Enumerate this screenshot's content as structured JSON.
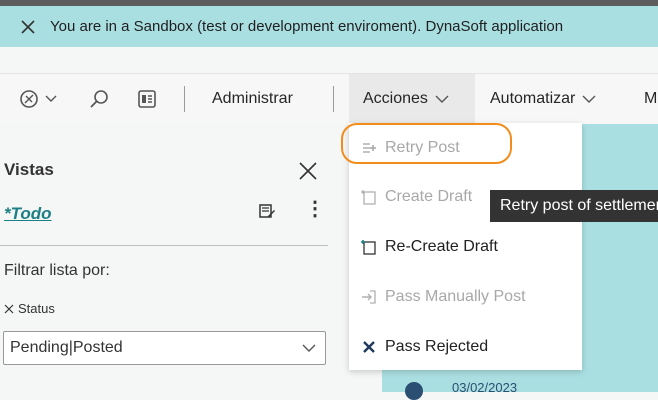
{
  "banner": {
    "text": "You are in a Sandbox (test or development enviroment). DynaSoft application"
  },
  "toolbar": {
    "administrar": "Administrar",
    "acciones": "Acciones",
    "automatizar": "Automatizar",
    "more": "M"
  },
  "menu": {
    "items": [
      {
        "label": "Retry Post",
        "enabled": false
      },
      {
        "label": "Create Draft",
        "enabled": false
      },
      {
        "label": "Re-Create Draft",
        "enabled": true
      },
      {
        "label": "Pass Manually Post",
        "enabled": false
      },
      {
        "label": "Pass Rejected",
        "enabled": true
      }
    ]
  },
  "tooltip": {
    "text": "Retry post of settlement"
  },
  "panel": {
    "title": "Vistas",
    "view": "*Todo",
    "filter_label": "Filtrar lista por:",
    "filter_field": "Status",
    "filter_value": "Pending|Posted"
  },
  "background": {
    "ref_text": "03/02/2023"
  },
  "colors": {
    "accent": "#1b7f83",
    "sandbox": "#aadfe2",
    "highlight": "#f28c1b"
  }
}
